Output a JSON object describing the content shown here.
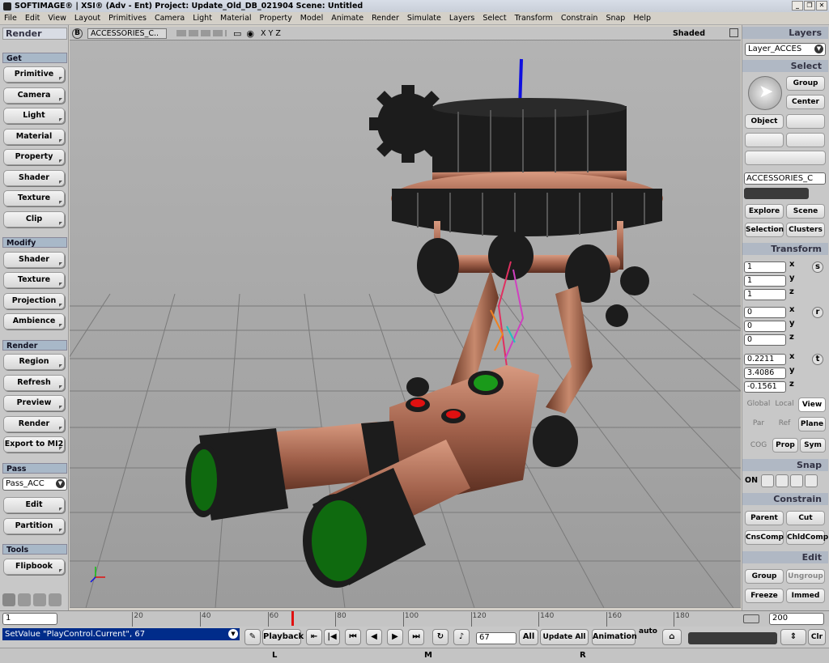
{
  "title": "SOFTIMAGE® | XSI® (Adv - Ent) Project: Update_Old_DB_021904   Scene: Untitled",
  "window_buttons": [
    "_",
    "❐",
    "✕"
  ],
  "menu": [
    "File",
    "Edit",
    "View",
    "Layout",
    "Primitives",
    "Camera",
    "Light",
    "Material",
    "Property",
    "Model",
    "Animate",
    "Render",
    "Simulate",
    "Layers",
    "Select",
    "Transform",
    "Constrain",
    "Snap",
    "Help"
  ],
  "left_panel": {
    "title": "Render",
    "sections": {
      "get": "Get",
      "modify": "Modify",
      "render": "Render",
      "pass": "Pass",
      "tools": "Tools"
    },
    "get_buttons": [
      "Primitive",
      "Camera",
      "Light",
      "Material",
      "Property",
      "Shader",
      "Texture",
      "Clip"
    ],
    "modify_buttons": [
      "Shader",
      "Texture",
      "Projection",
      "Ambience"
    ],
    "render_buttons": [
      "Region",
      "Refresh",
      "Preview",
      "Render",
      "Export to MI2"
    ],
    "pass_select": "Pass_ACC",
    "pass_buttons": [
      "Edit",
      "Partition"
    ],
    "tools_buttons": [
      "Flipbook"
    ]
  },
  "viewport": {
    "cam_letter": "B",
    "view_name": "ACCESSORIES_C..",
    "axes_label": "X Y Z",
    "shading": "Shaded",
    "colors": {
      "bg_top": "#b4b4b4",
      "bg_bottom": "#9c9c9c",
      "grid": "#7a7a7a",
      "copper": "#a0604a",
      "black": "#1c1c1c",
      "green": "#1a8a1a",
      "red": "#e01010"
    }
  },
  "right_panel": {
    "layers_title": "Layers",
    "layer_select": "Layer_ACCES",
    "select_title": "Select",
    "group_btn": "Group",
    "center_btn": "Center",
    "object_btn": "Object",
    "selection_name": "ACCESSORIES_C",
    "explore_btn": "Explore",
    "scene_btn": "Scene",
    "selection_btn": "Selection",
    "clusters_btn": "Clusters",
    "transform_title": "Transform",
    "scale": [
      "1",
      "1",
      "1"
    ],
    "rotate": [
      "0",
      "0",
      "0"
    ],
    "translate": [
      "0.2211",
      "3.4086",
      "-0.1561"
    ],
    "axis_labels": [
      "x",
      "y",
      "z"
    ],
    "srt_icons": [
      "s",
      "r",
      "t"
    ],
    "ref_row1": [
      "Global",
      "Local",
      "View"
    ],
    "ref_row2": [
      "Par",
      "Ref",
      "Plane"
    ],
    "ref_row3": [
      "COG",
      "Prop",
      "Sym"
    ],
    "snap_title": "Snap",
    "snap_on": "ON",
    "constrain_title": "Constrain",
    "parent_btn": "Parent",
    "cut_btn": "Cut",
    "cnscomp_btn": "CnsComp",
    "chldcomp_btn": "ChldComp",
    "edit_title": "Edit",
    "group2_btn": "Group",
    "ungroup_btn": "Ungroup",
    "freeze_btn": "Freeze",
    "immed_btn": "Immed"
  },
  "timeline": {
    "start": "1",
    "end": "200",
    "ticks": [
      "20",
      "40",
      "60",
      "80",
      "100",
      "120",
      "140",
      "160",
      "180"
    ],
    "current_frame": 67,
    "frame_count": 200
  },
  "bottom": {
    "command": "SetValue \"PlayControl.Current\", 67",
    "playback_btn": "Playback",
    "frame_field": "67",
    "all_btn": "All",
    "update_all_btn": "Update All",
    "animation_btn": "Animation",
    "auto_label": "auto",
    "clr_btn": "Clr"
  },
  "statusbar": {
    "l": "L",
    "m": "M",
    "r": "R"
  }
}
